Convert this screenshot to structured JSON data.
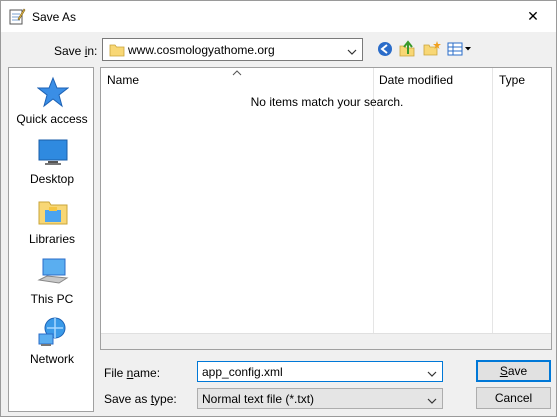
{
  "window": {
    "title": "Save As",
    "close_glyph": "✕"
  },
  "toolbar": {
    "save_in_label_pre": "Save ",
    "save_in_label_key": "i",
    "save_in_label_post": "n:",
    "save_in_value": "www.cosmologyathome.org",
    "icons": [
      "back-icon",
      "up-folder-icon",
      "new-folder-icon",
      "view-menu-icon"
    ]
  },
  "places": [
    {
      "label": "Quick access",
      "icon": "star-icon"
    },
    {
      "label": "Desktop",
      "icon": "desktop-icon"
    },
    {
      "label": "Libraries",
      "icon": "libraries-icon"
    },
    {
      "label": "This PC",
      "icon": "computer-icon"
    },
    {
      "label": "Network",
      "icon": "network-icon"
    }
  ],
  "filelist": {
    "columns": [
      "Name",
      "Date modified",
      "Type"
    ],
    "sort_column": "Name",
    "empty_message": "No items match your search."
  },
  "form": {
    "filename_label_pre": "File ",
    "filename_label_key": "n",
    "filename_label_post": "ame:",
    "filename_value": "app_config.xml",
    "savetype_label_pre": "Save as ",
    "savetype_label_key": "t",
    "savetype_label_post": "ype:",
    "savetype_value": "Normal text file (*.txt)"
  },
  "buttons": {
    "save_key": "S",
    "save_rest": "ave",
    "cancel": "Cancel"
  },
  "colors": {
    "accent": "#0078d7",
    "folder": "#f8d775",
    "window_bg": "#f0f0f0"
  }
}
